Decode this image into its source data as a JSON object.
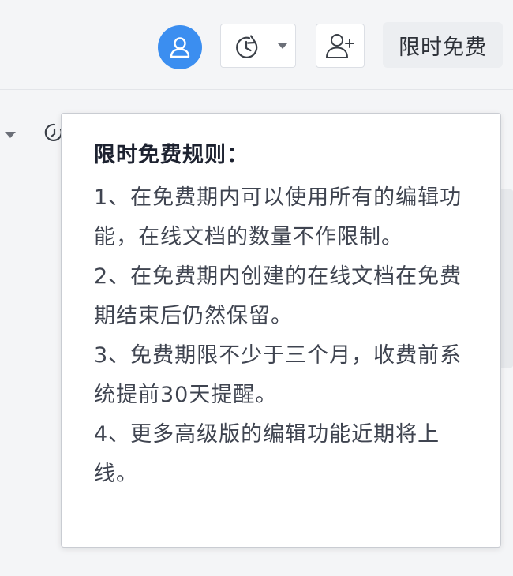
{
  "header": {
    "avatar_icon": "user-icon",
    "history_icon": "clock-history-icon",
    "history_dropdown_icon": "caret-down-icon",
    "add_member_icon": "add-user-icon",
    "free_button_label": "限时免费",
    "accent_color": "#3b8ef0"
  },
  "sidebar": {
    "caret_icon": "caret-down-icon",
    "partial_icon": "timer-icon"
  },
  "popover": {
    "title": "限时免费规则：",
    "rules": [
      "1、在免费期内可以使用所有的编辑功能，在线文档的数量不作限制。",
      "2、在免费期内创建的在线文档在免费期结束后仍然保留。",
      "3、免费期限不少于三个月，收费前系统提前30天提醒。",
      "4、更多高级版的编辑功能近期将上线。"
    ]
  }
}
